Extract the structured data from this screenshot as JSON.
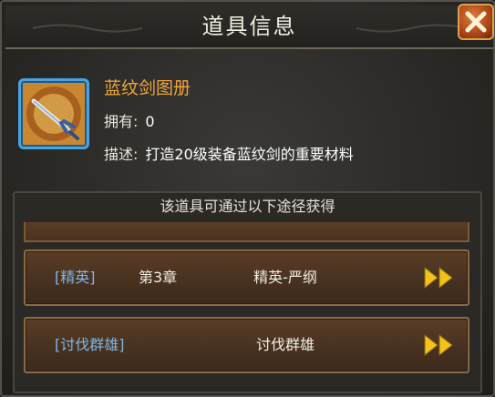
{
  "dialog": {
    "title": "道具信息",
    "close_icon": "close-x-icon"
  },
  "item": {
    "name": "蓝纹剑图册",
    "icon": "sword-scroll-icon",
    "own_label": "拥有:",
    "own_value": "0",
    "desc_label": "描述:",
    "desc_value": "打造20级装备蓝纹剑的重要材料"
  },
  "sources": {
    "header": "该道具可通过以下途径获得",
    "routes": [
      {
        "tag": "[精英]",
        "chapter": "第3章",
        "stage": "精英-严纲",
        "go_icon": "double-arrow-right-icon"
      },
      {
        "tag": "[讨伐群雄]",
        "chapter": "",
        "stage": "讨伐群雄",
        "go_icon": "double-arrow-right-icon"
      }
    ]
  },
  "colors": {
    "item_name": "#f0a53a",
    "route_tag": "#7fb6e8",
    "frame_blue": "#4aa3e0",
    "go_arrow": "#f2c21a"
  }
}
